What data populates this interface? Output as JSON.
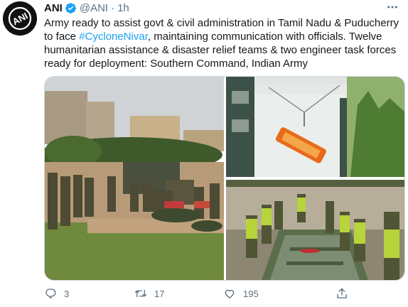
{
  "tweet": {
    "author_name": "ANI",
    "handle": "@ANI",
    "separator": "·",
    "time": "1h",
    "more_label": "···",
    "avatar_text": "ANI",
    "text_part1": "Army ready to assist govt & civil administration in Tamil Nadu & Puducherry to face ",
    "hashtag": "#CycloneNivar",
    "text_part2": ", maintaining communication with officials. Twelve humanitarian assistance & disaster relief teams & two engineer task forces ready for deployment: Southern Command, Indian Army"
  },
  "media": {
    "images": [
      {
        "icon": "army-personnel-assembling-photo"
      },
      {
        "icon": "rescue-stretcher-hoist-photo"
      },
      {
        "icon": "soldiers-boat-on-river-photo"
      }
    ]
  },
  "actions": {
    "reply_count": "3",
    "retweet_count": "17",
    "like_count": "195",
    "share_label": ""
  },
  "colors": {
    "accent": "#1da1f2",
    "secondary_text": "#5b7083",
    "text": "#14171a"
  },
  "icons": [
    "verified-badge-icon",
    "more-options-icon",
    "reply-icon",
    "retweet-icon",
    "like-icon",
    "share-icon"
  ]
}
